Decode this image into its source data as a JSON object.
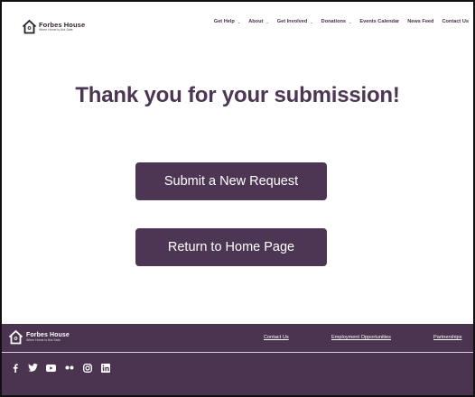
{
  "brand": {
    "name": "Forbes House",
    "tagline": "When Home is Not Safe."
  },
  "nav": {
    "items": [
      {
        "label": "Get Help",
        "dropdown": true
      },
      {
        "label": "About",
        "dropdown": true
      },
      {
        "label": "Get Involved",
        "dropdown": true
      },
      {
        "label": "Donations",
        "dropdown": true
      },
      {
        "label": "Events Calendar",
        "dropdown": false
      },
      {
        "label": "News Feed",
        "dropdown": false
      },
      {
        "label": "Contact Us",
        "dropdown": false
      }
    ]
  },
  "main": {
    "title": "Thank you for your submission!",
    "submit_new_label": "Submit a New Request",
    "return_home_label": "Return to Home Page"
  },
  "footer": {
    "links": [
      "Contact Us",
      "Employment Opportunities",
      "Partnerships"
    ],
    "social_icons": [
      "facebook-icon",
      "twitter-icon",
      "youtube-icon",
      "flickr-icon",
      "instagram-icon",
      "linkedin-icon"
    ]
  },
  "colors": {
    "brand_purple": "#4d3654",
    "footer_bg": "#4a3450",
    "nav_text": "#4a2f4f"
  }
}
